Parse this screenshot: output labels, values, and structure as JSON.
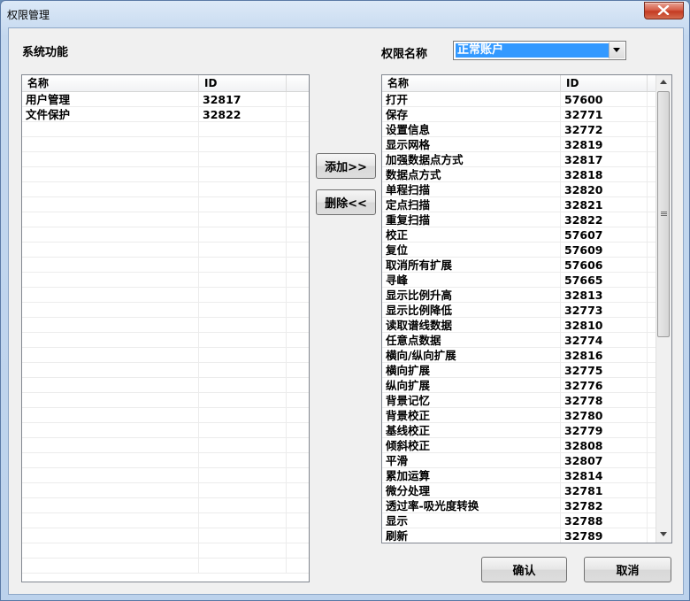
{
  "window": {
    "title": "权限管理"
  },
  "labels": {
    "system_functions": "系统功能",
    "permission_name": "权限名称"
  },
  "combo": {
    "selected": "正常账户"
  },
  "columns": {
    "name": "名称",
    "id": "ID"
  },
  "left_list": {
    "rows": [
      {
        "name": "用户管理",
        "id": "32817"
      },
      {
        "name": "文件保护",
        "id": "32822"
      }
    ]
  },
  "right_list": {
    "rows": [
      {
        "name": "打开",
        "id": "57600"
      },
      {
        "name": "保存",
        "id": "32771"
      },
      {
        "name": "设置信息",
        "id": "32772"
      },
      {
        "name": "显示网格",
        "id": "32819"
      },
      {
        "name": "加强数据点方式",
        "id": "32817"
      },
      {
        "name": "数据点方式",
        "id": "32818"
      },
      {
        "name": "单程扫描",
        "id": "32820"
      },
      {
        "name": "定点扫描",
        "id": "32821"
      },
      {
        "name": "重复扫描",
        "id": "32822"
      },
      {
        "name": "校正",
        "id": "57607"
      },
      {
        "name": "复位",
        "id": "57609"
      },
      {
        "name": "取消所有扩展",
        "id": "57606"
      },
      {
        "name": "寻峰",
        "id": "57665"
      },
      {
        "name": "显示比例升高",
        "id": "32813"
      },
      {
        "name": "显示比例降低",
        "id": "32773"
      },
      {
        "name": "读取谱线数据",
        "id": "32810"
      },
      {
        "name": "任意点数据",
        "id": "32774"
      },
      {
        "name": "横向/纵向扩展",
        "id": "32816"
      },
      {
        "name": "横向扩展",
        "id": "32775"
      },
      {
        "name": "纵向扩展",
        "id": "32776"
      },
      {
        "name": "背景记忆",
        "id": "32778"
      },
      {
        "name": "背景校正",
        "id": "32780"
      },
      {
        "name": "基线校正",
        "id": "32779"
      },
      {
        "name": "倾斜校正",
        "id": "32808"
      },
      {
        "name": "平滑",
        "id": "32807"
      },
      {
        "name": "累加运算",
        "id": "32814"
      },
      {
        "name": "微分处理",
        "id": "32781"
      },
      {
        "name": "透过率-吸光度转换",
        "id": "32782"
      },
      {
        "name": "显示",
        "id": "32788"
      },
      {
        "name": "刷新",
        "id": "32789"
      }
    ]
  },
  "buttons": {
    "add": "添加>>",
    "delete": "删除<<",
    "confirm": "确认",
    "cancel": "取消"
  },
  "icons": {
    "close": "close-icon",
    "dropdown": "chevron-down-icon"
  }
}
